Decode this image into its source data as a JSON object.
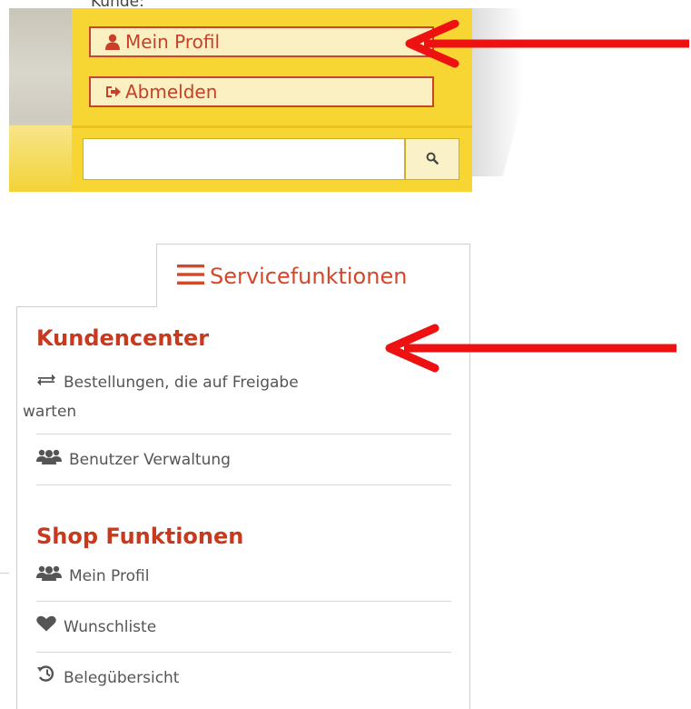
{
  "top_panel": {
    "partial_label": "Kunde:",
    "profile_button": {
      "label": "Mein Profil",
      "icon": "user-icon"
    },
    "logout_button": {
      "label": "Abmelden",
      "icon": "sign-out-icon"
    },
    "search": {
      "value": "",
      "placeholder": "",
      "icon": "search-icon"
    },
    "colors": {
      "panel": "#f7d633",
      "accent": "#c7402a"
    }
  },
  "service_menu": {
    "tab_label": "Servicefunktionen",
    "tab_icon": "hamburger-icon",
    "sections": [
      {
        "title": "Kundencenter",
        "items": [
          {
            "icon": "exchange-icon",
            "label_line1": "Bestellungen, die auf Freigabe",
            "label_line2": "warten"
          },
          {
            "icon": "users-icon",
            "label": "Benutzer Verwaltung"
          }
        ]
      },
      {
        "title": "Shop Funktionen",
        "items": [
          {
            "icon": "users-icon",
            "label": "Mein Profil"
          },
          {
            "icon": "heart-icon",
            "label": "Wunschliste"
          },
          {
            "icon": "history-icon",
            "label": "Belegübersicht"
          }
        ]
      }
    ],
    "colors": {
      "heading": "#c8391d",
      "text": "#555555"
    }
  },
  "annotations": {
    "arrow_color": "#ee1111",
    "arrow_count": 2
  }
}
